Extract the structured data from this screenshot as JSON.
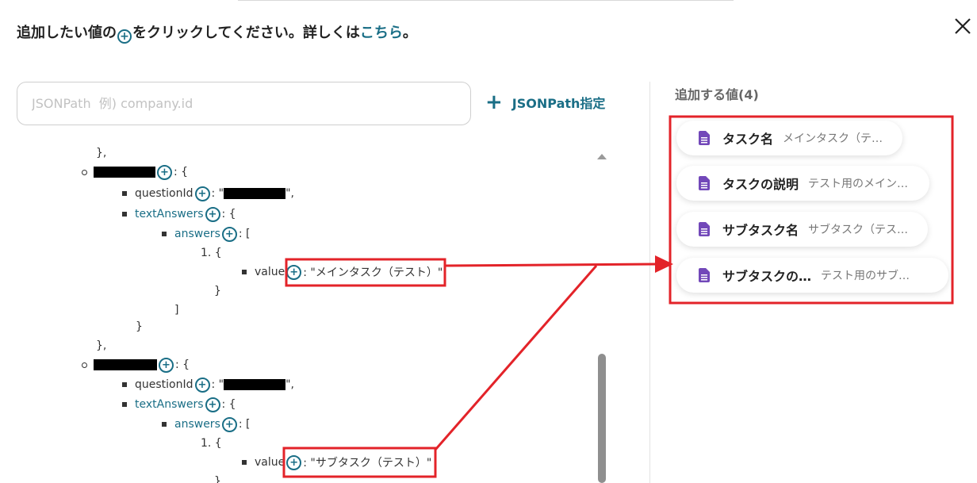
{
  "header": {
    "instruction_before": "追加したい値の",
    "instruction_after": "をクリックしてください。詳しくは",
    "instruction_link": "こちら",
    "instruction_end": "。"
  },
  "search": {
    "placeholder": "JSONPath  例) company.id"
  },
  "jsonpath_button": {
    "plus": "+",
    "label": "JSONPath指定"
  },
  "tree": {
    "closing_brace_comma": "},",
    "open_brace": ": {",
    "open_bracket": ": [",
    "close_bracket": "]",
    "close_brace": "}",
    "question_id_key": "questionId",
    "question_id_colon": ": \"",
    "question_id_end": "\",",
    "text_answers_key": "textAnswers",
    "answers_key": "answers",
    "index_label": "1. {",
    "value_key": "value",
    "value1": ": \"メインタスク（テスト）\"",
    "value2": ": \"サブタスク（テスト）\""
  },
  "panel": {
    "heading": "追加する値(4)",
    "items": [
      {
        "name": "タスク名",
        "value": "メインタスク（テ…"
      },
      {
        "name": "タスクの説明",
        "value": "テスト用のメイン…"
      },
      {
        "name": "サブタスク名",
        "value": "サブタスク（テス…"
      },
      {
        "name": "サブタスクの…",
        "value": "テスト用のサブ…"
      }
    ]
  },
  "colors": {
    "accent": "#1a6e86",
    "highlight": "#e32329",
    "doc_icon": "#7248b9"
  },
  "icons": {
    "close": "close-icon",
    "add": "plus-circle-icon",
    "document": "document-icon"
  }
}
